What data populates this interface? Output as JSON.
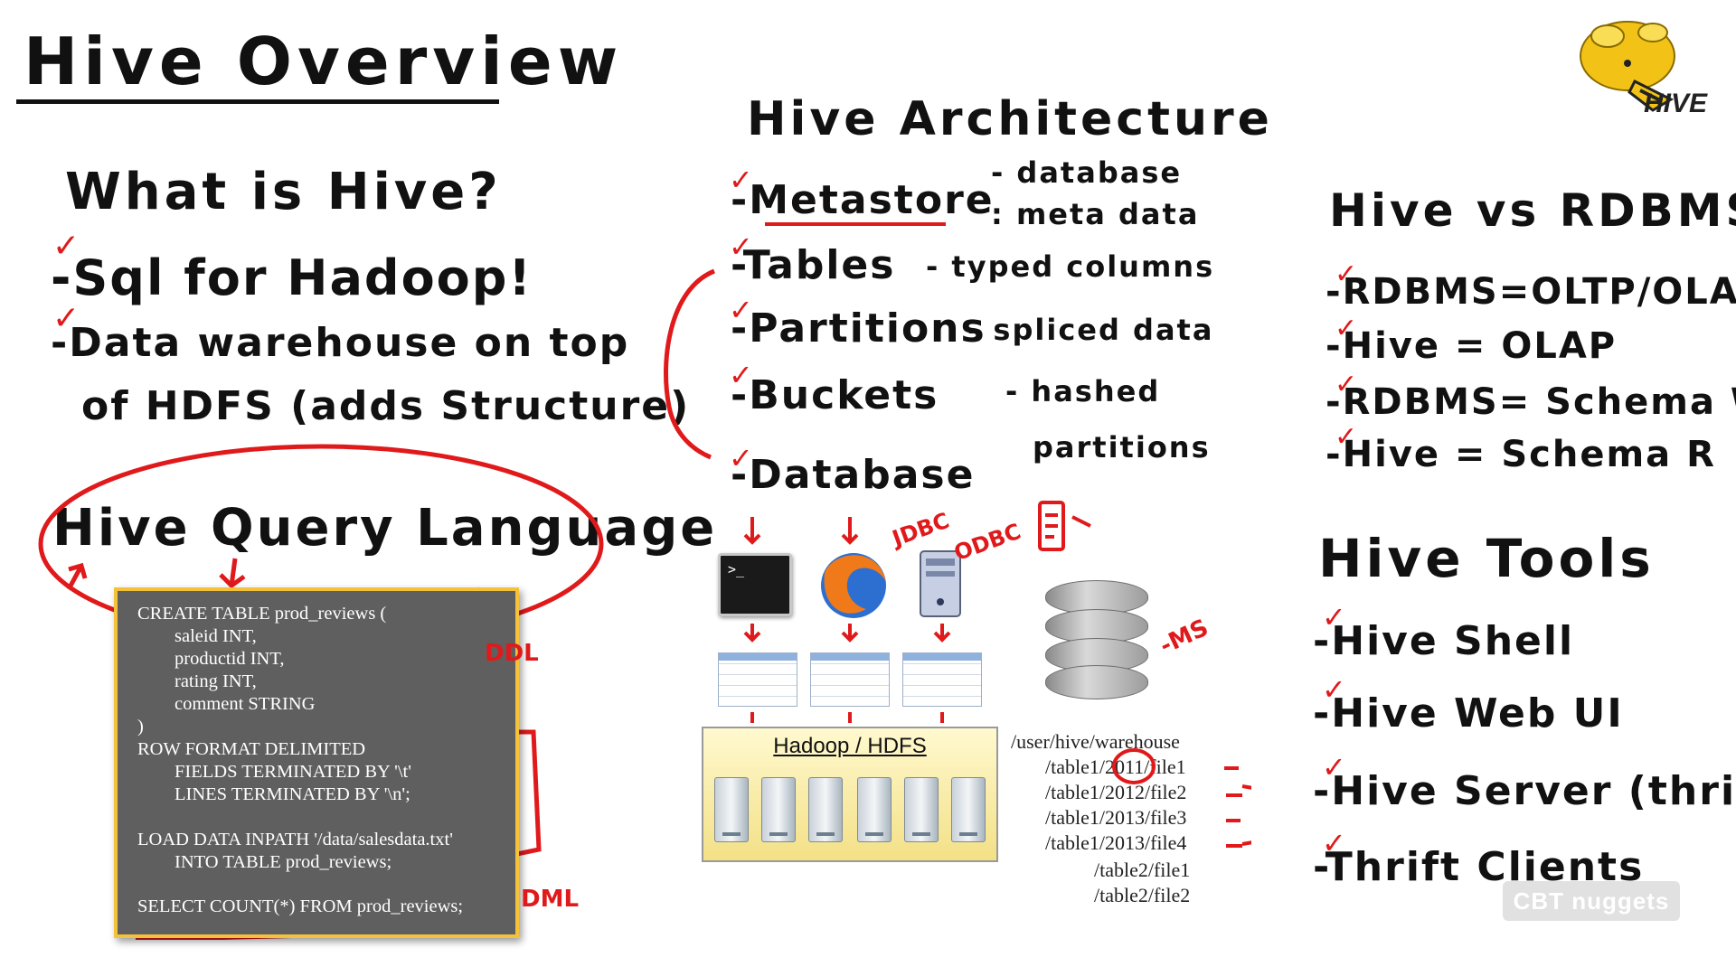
{
  "main_title": "Hive Overview",
  "left": {
    "question": "What is Hive?",
    "items": [
      "-Sql for Hadoop!",
      "-Data warehouse on top",
      "of HDFS (adds Structure)"
    ],
    "hql_heading": "Hive Query Language",
    "sql": [
      "CREATE TABLE prod_reviews (",
      "        saleid INT,",
      "        productid INT,",
      "        rating INT,",
      "        comment STRING",
      ")",
      "ROW FORMAT DELIMITED",
      "        FIELDS TERMINATED BY '\\t'",
      "        LINES TERMINATED BY '\\n';",
      "",
      "LOAD DATA INPATH '/data/salesdata.txt'",
      "        INTO TABLE prod_reviews;",
      "",
      "SELECT COUNT(*) FROM prod_reviews;"
    ],
    "ddl_note": "DDL",
    "dml_note": "DML"
  },
  "middle": {
    "heading": "Hive Architecture",
    "items": [
      {
        "label": "-Metastore",
        "note": "- database"
      },
      {
        "label": "-Tables",
        "note": "- typed columns"
      },
      {
        "label": "-Partitions",
        "note": "- spliced data"
      },
      {
        "label": "-Buckets",
        "note": "- hashed"
      },
      {
        "label": "-Database",
        "note": ""
      }
    ],
    "metastore_note2": ": meta data",
    "buckets_note2": "partitions",
    "jdbc_note": "JDBC",
    "odbc_note": "ODBC",
    "terminal_prompt": ">_",
    "hdfs_label": "Hadoop / HDFS",
    "ms_note": "-MS",
    "paths": [
      "/user/hive/warehouse",
      "/table1/2011/file1",
      "/table1/2012/file2",
      "/table1/2013/file3",
      "/table1/2013/file4",
      "/table2/file1",
      "/table2/file2"
    ]
  },
  "right": {
    "vs_heading": "Hive vs RDBMS",
    "vs_items": [
      "-RDBMS=OLTP/OLAP",
      "-Hive = OLAP",
      "-RDBMS= Schema W",
      "-Hive = Schema R"
    ],
    "tools_heading": "Hive Tools",
    "tools_items": [
      "-Hive Shell",
      "-Hive Web UI",
      "-Hive Server (thrift)",
      "-Thrift Clients"
    ]
  },
  "logo_text": "HIVE",
  "watermark": "CBT nuggets",
  "colors": {
    "ink": "#111111",
    "annotation": "#e0191b",
    "sql_bg": "#5f5f5f",
    "sql_border": "#f3c23a",
    "logo": "#f2c316"
  }
}
